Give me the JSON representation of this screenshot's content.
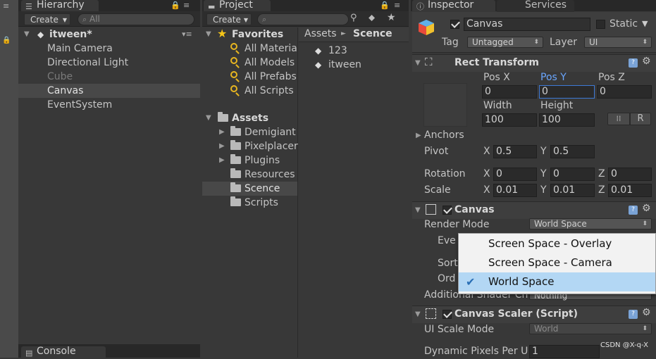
{
  "hierarchy": {
    "tab_label": "Hierarchy",
    "create_label": "Create",
    "search_placeholder": "All",
    "scene_name": "itween*",
    "items": [
      {
        "label": "Main Camera",
        "dim": false,
        "selected": false
      },
      {
        "label": "Directional Light",
        "dim": false,
        "selected": false
      },
      {
        "label": "Cube",
        "dim": true,
        "selected": false
      },
      {
        "label": "Canvas",
        "dim": false,
        "selected": true
      },
      {
        "label": "EventSystem",
        "dim": false,
        "selected": false
      }
    ],
    "console_tab_label": "Console"
  },
  "project": {
    "tab_label": "Project",
    "create_label": "Create",
    "favorites_label": "Favorites",
    "favorites": [
      "All Materia",
      "All Models",
      "All Prefabs",
      "All Scripts"
    ],
    "assets_label": "Assets",
    "folders": [
      {
        "label": "Demigiant",
        "expandable": true
      },
      {
        "label": "Pixelplacer",
        "expandable": true
      },
      {
        "label": "Plugins",
        "expandable": true
      },
      {
        "label": "Resources",
        "expandable": false
      },
      {
        "label": "Scence",
        "expandable": false,
        "selected": true
      },
      {
        "label": "Scripts",
        "expandable": false
      }
    ],
    "breadcrumb": [
      "Assets",
      "Scence"
    ],
    "breadcrumb_sep": "►",
    "files": [
      "123",
      "itween"
    ]
  },
  "inspector": {
    "tab_label": "Inspector",
    "services_tab_label": "Services",
    "object_name": "Canvas",
    "static_label": "Static",
    "tag_label": "Tag",
    "tag_value": "Untagged",
    "layer_label": "Layer",
    "layer_value": "UI",
    "rect_transform": {
      "title": "Rect Transform",
      "pos_x_label": "Pos X",
      "pos_y_label": "Pos Y",
      "pos_z_label": "Pos Z",
      "pos_x": "0",
      "pos_y": "0",
      "pos_z": "0",
      "width_label": "Width",
      "height_label": "Height",
      "width": "100",
      "height": "100",
      "r_button": "R",
      "anchors_label": "Anchors",
      "pivot_label": "Pivot",
      "pivot_x": "0.5",
      "pivot_y": "0.5",
      "rotation_label": "Rotation",
      "rot_x": "0",
      "rot_y": "0",
      "rot_z": "0",
      "scale_label": "Scale",
      "scale_x": "0.01",
      "scale_y": "0.01",
      "scale_z": "0.01",
      "x_label": "X",
      "y_label": "Y",
      "z_label": "Z"
    },
    "canvas": {
      "title": "Canvas",
      "render_mode_label": "Render Mode",
      "render_mode_value": "World Space",
      "event_label_partial": "Eve",
      "sort_label_partial": "Sort",
      "order_label_partial": "Ord",
      "additional_label": "Additional Shader Ch",
      "additional_value": "Nothing"
    },
    "canvas_scaler": {
      "title": "Canvas Scaler (Script)",
      "ui_scale_mode_label": "UI Scale Mode",
      "ui_scale_mode_value": "World",
      "dynamic_pixels_label": "Dynamic Pixels Per U",
      "dynamic_pixels_value": "1"
    }
  },
  "render_mode_popup": {
    "options": [
      {
        "label": "Screen Space - Overlay",
        "checked": false
      },
      {
        "label": "Screen Space - Camera",
        "checked": false
      },
      {
        "label": "World Space",
        "checked": true
      }
    ]
  },
  "watermark": "CSDN @X-q-X",
  "colors": {
    "selection": "#484848",
    "accent_blue": "#7aa3d6",
    "popup_highlight": "#b3d7f4",
    "favorites_star": "#f5c518"
  }
}
